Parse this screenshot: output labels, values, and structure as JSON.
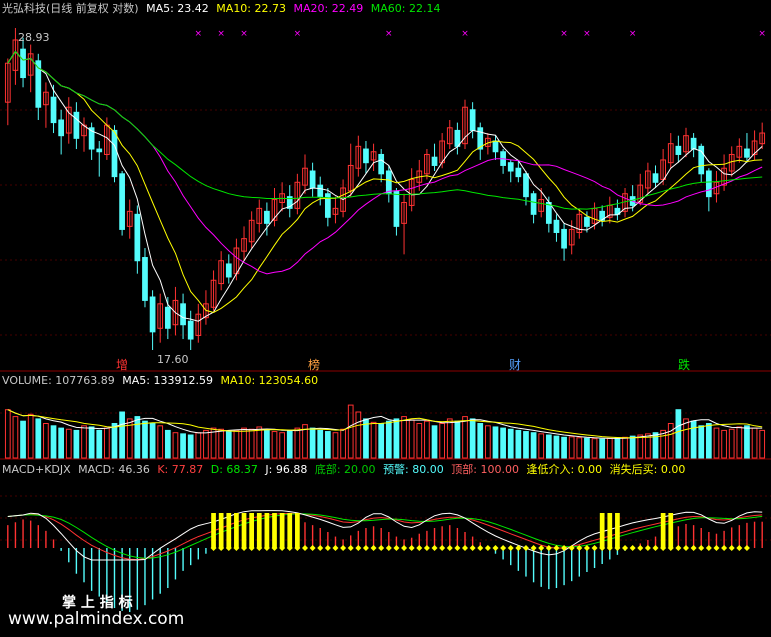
{
  "header_main": {
    "title": "光弘科技(日线 前复权 对数)",
    "ma5_label": "MA5: 23.42",
    "ma10_label": "MA10: 22.73",
    "ma20_label": "MA20: 22.49",
    "ma60_label": "MA60: 22.14"
  },
  "header_volume": {
    "volume_label": "VOLUME: 107763.89",
    "ma5_label": "MA5: 133912.59",
    "ma10_label": "MA10: 123054.60"
  },
  "header_macd": {
    "name": "MACD+KDJX",
    "macd_label": "MACD: 46.36",
    "k_label": "K: 77.87",
    "d_label": "D: 68.37",
    "j_label": "J: 96.88",
    "bottom_label": "底部: 20.00",
    "warn_label": "预警: 80.00",
    "top_label": "顶部: 100.00",
    "dip_label": "逢低介入: 0.00",
    "vanish_label": "消失后买: 0.00"
  },
  "annotations": {
    "high_price": "28.93",
    "low_price": "17.60",
    "marker_1": "增",
    "marker_2": "榜",
    "marker_3": "财",
    "marker_4": "跌"
  },
  "watermark": {
    "brand": "掌 上 指 标",
    "url": "www.palmindex.com"
  },
  "colors": {
    "up": "#ff3232",
    "down": "#54fcfc",
    "ma5": "#ffffff",
    "ma10": "#ffff00",
    "ma20": "#ff00ff",
    "ma60": "#00e600",
    "grid": "#8b0000",
    "yellow_signal": "#ffff00"
  },
  "chart_data": {
    "type": "candlestick",
    "price_range": [
      17.6,
      28.93
    ],
    "candles": [
      [
        25.8,
        27.4,
        24.9,
        27.6
      ],
      [
        27.1,
        28.4,
        26.5,
        28.93
      ],
      [
        28.0,
        26.8,
        26.4,
        28.5
      ],
      [
        26.9,
        27.8,
        26.2,
        28.2
      ],
      [
        27.5,
        25.6,
        25.1,
        27.8
      ],
      [
        25.7,
        26.2,
        24.8,
        26.6
      ],
      [
        26.0,
        25.0,
        24.6,
        26.5
      ],
      [
        25.1,
        24.5,
        23.8,
        25.5
      ],
      [
        24.6,
        25.6,
        24.2,
        26.0
      ],
      [
        25.4,
        24.4,
        24.0,
        25.8
      ],
      [
        24.5,
        24.9,
        23.9,
        25.2
      ],
      [
        24.8,
        24.0,
        23.6,
        25.0
      ],
      [
        24.0,
        23.9,
        23.0,
        24.3
      ],
      [
        23.8,
        24.9,
        23.6,
        25.2
      ],
      [
        24.7,
        23.0,
        22.8,
        24.9
      ],
      [
        23.1,
        21.2,
        21.0,
        23.2
      ],
      [
        21.3,
        21.8,
        20.9,
        22.2
      ],
      [
        21.7,
        20.2,
        19.8,
        22.0
      ],
      [
        20.3,
        19.0,
        18.8,
        20.6
      ],
      [
        19.1,
        18.1,
        17.6,
        19.3
      ],
      [
        18.2,
        18.9,
        17.8,
        19.2
      ],
      [
        18.8,
        18.2,
        17.9,
        19.1
      ],
      [
        18.3,
        19.0,
        18.0,
        19.4
      ],
      [
        18.9,
        18.3,
        17.9,
        19.2
      ],
      [
        18.4,
        17.9,
        17.6,
        18.7
      ],
      [
        18.0,
        18.6,
        17.8,
        18.9
      ],
      [
        18.5,
        18.9,
        18.3,
        19.3
      ],
      [
        18.8,
        19.6,
        18.7,
        19.9
      ],
      [
        19.5,
        20.2,
        19.3,
        20.5
      ],
      [
        20.1,
        19.7,
        19.5,
        20.4
      ],
      [
        19.8,
        20.6,
        19.6,
        20.9
      ],
      [
        20.5,
        20.9,
        20.2,
        21.3
      ],
      [
        20.8,
        21.5,
        20.6,
        21.8
      ],
      [
        21.4,
        21.9,
        21.1,
        22.2
      ],
      [
        21.8,
        21.4,
        21.0,
        22.1
      ],
      [
        21.5,
        22.2,
        21.3,
        22.6
      ],
      [
        22.1,
        22.4,
        21.8,
        22.8
      ],
      [
        22.3,
        21.9,
        21.6,
        22.7
      ],
      [
        21.9,
        22.8,
        21.7,
        23.1
      ],
      [
        22.7,
        23.3,
        22.4,
        23.8
      ],
      [
        23.2,
        22.6,
        22.3,
        23.5
      ],
      [
        22.7,
        22.3,
        22.0,
        23.0
      ],
      [
        22.4,
        21.6,
        21.3,
        22.6
      ],
      [
        21.7,
        21.9,
        21.4,
        22.3
      ],
      [
        21.8,
        22.6,
        21.6,
        22.9
      ],
      [
        22.5,
        23.4,
        22.3,
        24.2
      ],
      [
        23.3,
        24.1,
        23.0,
        24.5
      ],
      [
        24.0,
        23.5,
        23.1,
        24.3
      ],
      [
        23.6,
        23.9,
        23.2,
        24.2
      ],
      [
        23.8,
        23.1,
        22.8,
        24.0
      ],
      [
        23.2,
        22.4,
        22.1,
        23.4
      ],
      [
        22.5,
        21.3,
        21.0,
        22.6
      ],
      [
        21.4,
        22.1,
        20.4,
        22.4
      ],
      [
        22.0,
        22.9,
        21.8,
        23.3
      ],
      [
        22.8,
        23.2,
        22.5,
        23.6
      ],
      [
        23.1,
        23.8,
        22.9,
        24.0
      ],
      [
        23.7,
        23.4,
        23.2,
        24.2
      ],
      [
        23.5,
        24.3,
        23.3,
        24.6
      ],
      [
        24.2,
        24.8,
        24.0,
        25.1
      ],
      [
        24.7,
        24.1,
        23.8,
        25.0
      ],
      [
        24.2,
        25.6,
        24.0,
        25.9
      ],
      [
        25.5,
        24.7,
        24.4,
        25.8
      ],
      [
        24.8,
        24.0,
        23.6,
        25.0
      ],
      [
        24.1,
        24.4,
        23.8,
        24.6
      ],
      [
        24.3,
        23.9,
        23.6,
        24.5
      ],
      [
        23.9,
        23.4,
        23.1,
        24.0
      ],
      [
        23.5,
        23.2,
        22.8,
        23.6
      ],
      [
        23.3,
        23.0,
        22.8,
        23.6
      ],
      [
        23.1,
        22.3,
        22.0,
        23.2
      ],
      [
        22.4,
        21.7,
        21.4,
        22.5
      ],
      [
        21.8,
        22.2,
        21.6,
        22.6
      ],
      [
        22.1,
        21.4,
        21.1,
        22.3
      ],
      [
        21.5,
        21.1,
        20.8,
        21.7
      ],
      [
        21.2,
        20.6,
        20.2,
        21.4
      ],
      [
        20.7,
        21.2,
        20.4,
        21.5
      ],
      [
        21.1,
        21.7,
        20.9,
        21.9
      ],
      [
        21.6,
        21.3,
        21.1,
        21.8
      ],
      [
        21.4,
        21.9,
        21.2,
        22.1
      ],
      [
        21.8,
        21.5,
        21.3,
        22.0
      ],
      [
        21.6,
        22.0,
        21.4,
        22.3
      ],
      [
        21.9,
        21.7,
        21.5,
        22.2
      ],
      [
        21.8,
        22.4,
        21.6,
        22.6
      ],
      [
        22.3,
        22.0,
        21.8,
        22.7
      ],
      [
        22.1,
        22.7,
        22.0,
        23.1
      ],
      [
        22.6,
        23.2,
        22.4,
        23.5
      ],
      [
        23.1,
        22.8,
        22.6,
        23.4
      ],
      [
        22.9,
        23.6,
        22.7,
        24.0
      ],
      [
        23.5,
        24.2,
        23.3,
        24.6
      ],
      [
        24.1,
        23.8,
        23.5,
        24.5
      ],
      [
        23.9,
        24.5,
        23.7,
        24.8
      ],
      [
        24.4,
        24.0,
        23.7,
        24.6
      ],
      [
        24.1,
        23.1,
        22.8,
        24.2
      ],
      [
        23.2,
        22.3,
        21.8,
        23.3
      ],
      [
        22.4,
        22.8,
        22.1,
        23.2
      ],
      [
        22.7,
        23.3,
        22.5,
        23.8
      ],
      [
        23.2,
        23.8,
        23.0,
        24.1
      ],
      [
        23.7,
        24.1,
        23.5,
        24.4
      ],
      [
        24.0,
        23.7,
        23.5,
        24.6
      ],
      [
        23.8,
        24.3,
        23.6,
        24.7
      ],
      [
        24.2,
        24.6,
        24.0,
        25.0
      ]
    ],
    "volume_range": [
      0,
      300000
    ],
    "volume": [
      210000,
      180000,
      160000,
      190000,
      170000,
      150000,
      140000,
      130000,
      125000,
      120000,
      140000,
      135000,
      120000,
      130000,
      150000,
      200000,
      170000,
      180000,
      160000,
      150000,
      140000,
      120000,
      110000,
      105000,
      100000,
      110000,
      120000,
      130000,
      125000,
      115000,
      120000,
      130000,
      125000,
      135000,
      120000,
      115000,
      110000,
      120000,
      130000,
      145000,
      130000,
      120000,
      115000,
      110000,
      125000,
      230000,
      200000,
      170000,
      155000,
      150000,
      160000,
      170000,
      180000,
      165000,
      150000,
      160000,
      140000,
      150000,
      170000,
      160000,
      180000,
      170000,
      150000,
      140000,
      135000,
      130000,
      125000,
      120000,
      115000,
      110000,
      105000,
      100000,
      95000,
      90000,
      92000,
      88000,
      86000,
      84000,
      82000,
      85000,
      88000,
      90000,
      95000,
      100000,
      105000,
      110000,
      120000,
      150000,
      210000,
      170000,
      160000,
      140000,
      150000,
      130000,
      120000,
      125000,
      135000,
      140000,
      130000,
      120000
    ],
    "macd_range": [
      -120,
      80
    ],
    "macd": [
      40,
      45,
      50,
      48,
      40,
      30,
      15,
      -5,
      -25,
      -45,
      -60,
      -75,
      -85,
      -95,
      -105,
      -110,
      -112,
      -108,
      -100,
      -90,
      -80,
      -70,
      -55,
      -40,
      -30,
      -20,
      -10,
      0,
      10,
      20,
      30,
      35,
      40,
      45,
      48,
      50,
      52,
      50,
      48,
      45,
      40,
      35,
      28,
      20,
      15,
      22,
      30,
      35,
      38,
      35,
      28,
      20,
      15,
      18,
      25,
      30,
      35,
      38,
      40,
      35,
      28,
      20,
      10,
      0,
      -10,
      -20,
      -30,
      -40,
      -50,
      -60,
      -68,
      -72,
      -70,
      -65,
      -58,
      -50,
      -42,
      -35,
      -28,
      -20,
      -12,
      -5,
      2,
      8,
      14,
      20,
      26,
      32,
      38,
      42,
      40,
      35,
      28,
      25,
      30,
      36,
      40,
      44,
      46,
      46
    ]
  }
}
